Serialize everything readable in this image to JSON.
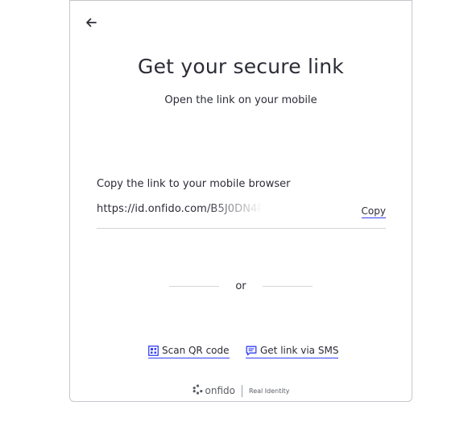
{
  "header": {
    "back_icon": "arrow-left-icon",
    "title": "Get your secure link",
    "subtitle": "Open the link on your mobile"
  },
  "link_section": {
    "label": "Copy the link to your mobile browser",
    "link_value": "https://id.onfido.com/B5J0DN4P",
    "copy_label": "Copy"
  },
  "separator": {
    "text": "or"
  },
  "options": [
    {
      "label": "Scan QR code",
      "icon": "qr-code-icon"
    },
    {
      "label": "Get link via SMS",
      "icon": "sms-icon"
    }
  ],
  "footer": {
    "brand": "onfido",
    "tagline": "Real Identity"
  },
  "colors": {
    "accent": "#353ff4",
    "text": "#2c2c38",
    "border": "#c4c7cc"
  }
}
